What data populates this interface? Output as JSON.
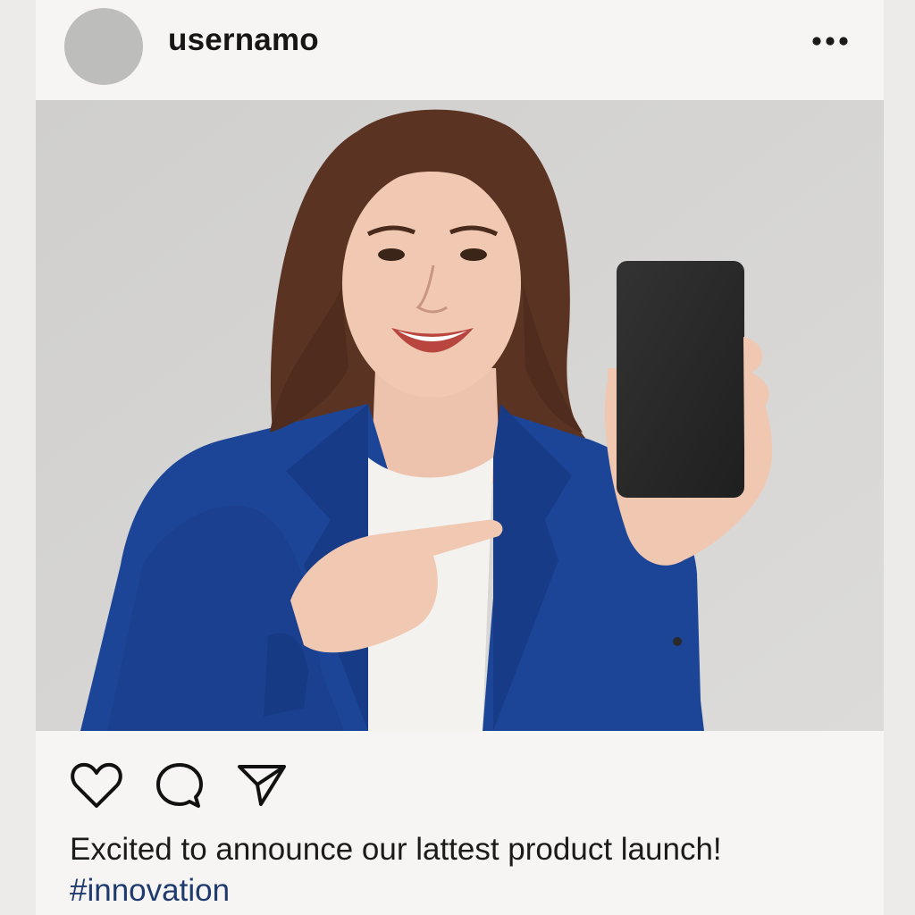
{
  "post": {
    "username": "usernamo",
    "caption": "Excited to announce our lattest product launch!",
    "hashtag": "#innovation"
  },
  "icons": {
    "more": "more-horizontal-icon",
    "like": "heart-icon",
    "comment": "comment-bubble-icon",
    "share": "paper-plane-icon"
  },
  "colors": {
    "page_background": "#ecebe9",
    "card_background": "#f6f5f3",
    "avatar_placeholder": "#bdbdbb",
    "image_background": "#d2d1cf",
    "blazer": "#1d4597",
    "phone": "#2a2a2a",
    "hashtag": "#1f3a6e"
  }
}
